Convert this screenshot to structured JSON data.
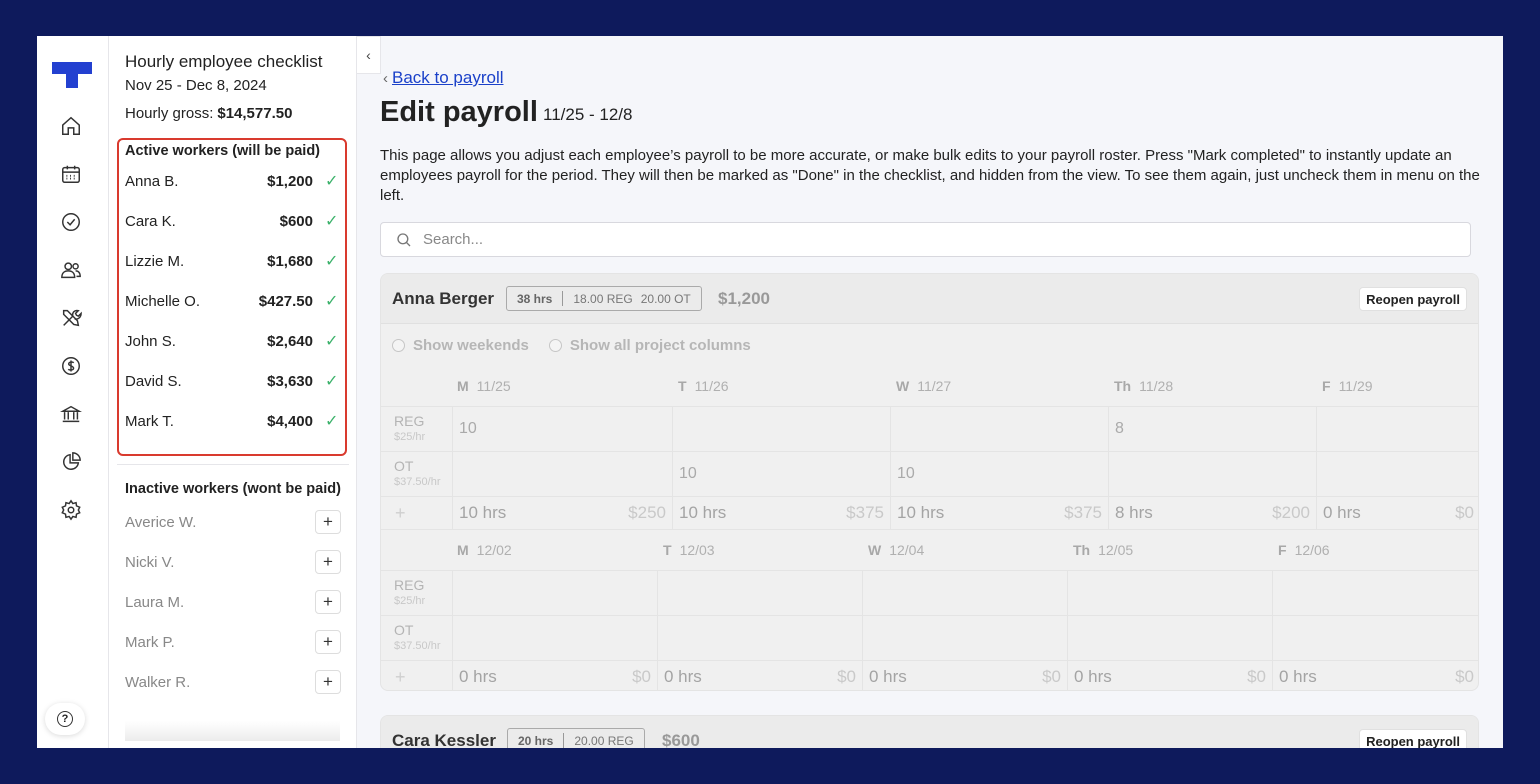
{
  "rail": {
    "items": [
      {
        "icon": "home-icon"
      },
      {
        "icon": "calendar-icon"
      },
      {
        "icon": "check-circle-icon"
      },
      {
        "icon": "people-icon"
      },
      {
        "icon": "tools-icon"
      },
      {
        "icon": "dollar-icon"
      },
      {
        "icon": "bank-icon"
      },
      {
        "icon": "pie-chart-icon"
      },
      {
        "icon": "gear-icon"
      }
    ],
    "help_icon": "help-icon",
    "help_label": "?"
  },
  "checklist": {
    "title": "Hourly employee checklist",
    "dates": "Nov 25 - Dec 8, 2024",
    "gross_label": "Hourly gross:",
    "gross_value": "$14,577.50",
    "active_heading": "Active workers (will be paid)",
    "active_workers": [
      {
        "name": "Anna B.",
        "amount": "$1,200",
        "check": "✓"
      },
      {
        "name": "Cara K.",
        "amount": "$600",
        "check": "✓"
      },
      {
        "name": "Lizzie M.",
        "amount": "$1,680",
        "check": "✓"
      },
      {
        "name": "Michelle O.",
        "amount": "$427.50",
        "check": "✓"
      },
      {
        "name": "John S.",
        "amount": "$2,640",
        "check": "✓"
      },
      {
        "name": "David S.",
        "amount": "$3,630",
        "check": "✓"
      },
      {
        "name": "Mark T.",
        "amount": "$4,400",
        "check": "✓"
      }
    ],
    "inactive_heading": "Inactive workers (wont be paid)",
    "inactive_workers": [
      {
        "name": "Averice W."
      },
      {
        "name": "Nicki V."
      },
      {
        "name": "Laura M."
      },
      {
        "name": "Mark P."
      },
      {
        "name": "Walker R."
      }
    ],
    "add_label": "+",
    "collapse_label": "‹"
  },
  "main": {
    "back_label": "Back to payroll",
    "back_chevron": "‹",
    "title": "Edit payroll",
    "range": "11/25 - 12/8",
    "description": "This page allows you adjust each employee’s payroll to be more accurate, or make bulk edits to your payroll roster. Press \"Mark completed\" to instantly update an employees payroll for the period. They will then be marked as \"Done\" in the checklist, and hidden from the view. To see them again, just uncheck them in menu on the left.",
    "search_placeholder": "Search...",
    "employees": [
      {
        "name": "Anna Berger",
        "hours": "38 hrs",
        "reg": "18.00 REG",
        "ot": "20.00 OT",
        "total": "$1,200",
        "reopen_label": "Reopen payroll",
        "show_weekends": "Show weekends",
        "show_projects": "Show all project columns",
        "reg_label": "REG",
        "reg_rate": "$25/hr",
        "ot_label": "OT",
        "ot_rate": "$37.50/hr",
        "add_symbol": "+",
        "week1": {
          "days": [
            {
              "letter": "M",
              "date": "11/25",
              "reg": "10",
              "ot": "",
              "hrs": "10 hrs",
              "amt": "$250"
            },
            {
              "letter": "T",
              "date": "11/26",
              "reg": "",
              "ot": "10",
              "hrs": "10 hrs",
              "amt": "$375"
            },
            {
              "letter": "W",
              "date": "11/27",
              "reg": "",
              "ot": "10",
              "hrs": "10 hrs",
              "amt": "$375"
            },
            {
              "letter": "Th",
              "date": "11/28",
              "reg": "8",
              "ot": "",
              "hrs": "8 hrs",
              "amt": "$200"
            },
            {
              "letter": "F",
              "date": "11/29",
              "reg": "",
              "ot": "",
              "hrs": "0 hrs",
              "amt": "$0"
            }
          ]
        },
        "week2": {
          "days": [
            {
              "letter": "M",
              "date": "12/02",
              "reg": "",
              "ot": "",
              "hrs": "0 hrs",
              "amt": "$0"
            },
            {
              "letter": "T",
              "date": "12/03",
              "reg": "",
              "ot": "",
              "hrs": "0 hrs",
              "amt": "$0"
            },
            {
              "letter": "W",
              "date": "12/04",
              "reg": "",
              "ot": "",
              "hrs": "0 hrs",
              "amt": "$0"
            },
            {
              "letter": "Th",
              "date": "12/05",
              "reg": "",
              "ot": "",
              "hrs": "0 hrs",
              "amt": "$0"
            },
            {
              "letter": "F",
              "date": "12/06",
              "reg": "",
              "ot": "",
              "hrs": "0 hrs",
              "amt": "$0"
            }
          ]
        }
      },
      {
        "name": "Cara Kessler",
        "hours": "20 hrs",
        "reg": "20.00 REG",
        "total": "$600",
        "reopen_label": "Reopen payroll"
      }
    ]
  },
  "colors": {
    "background": "#0e1a5c",
    "brand_blue": "#2340d0",
    "link": "#1b41c9",
    "highlight_border": "#d93a2e",
    "check_green": "#3cb26b"
  }
}
